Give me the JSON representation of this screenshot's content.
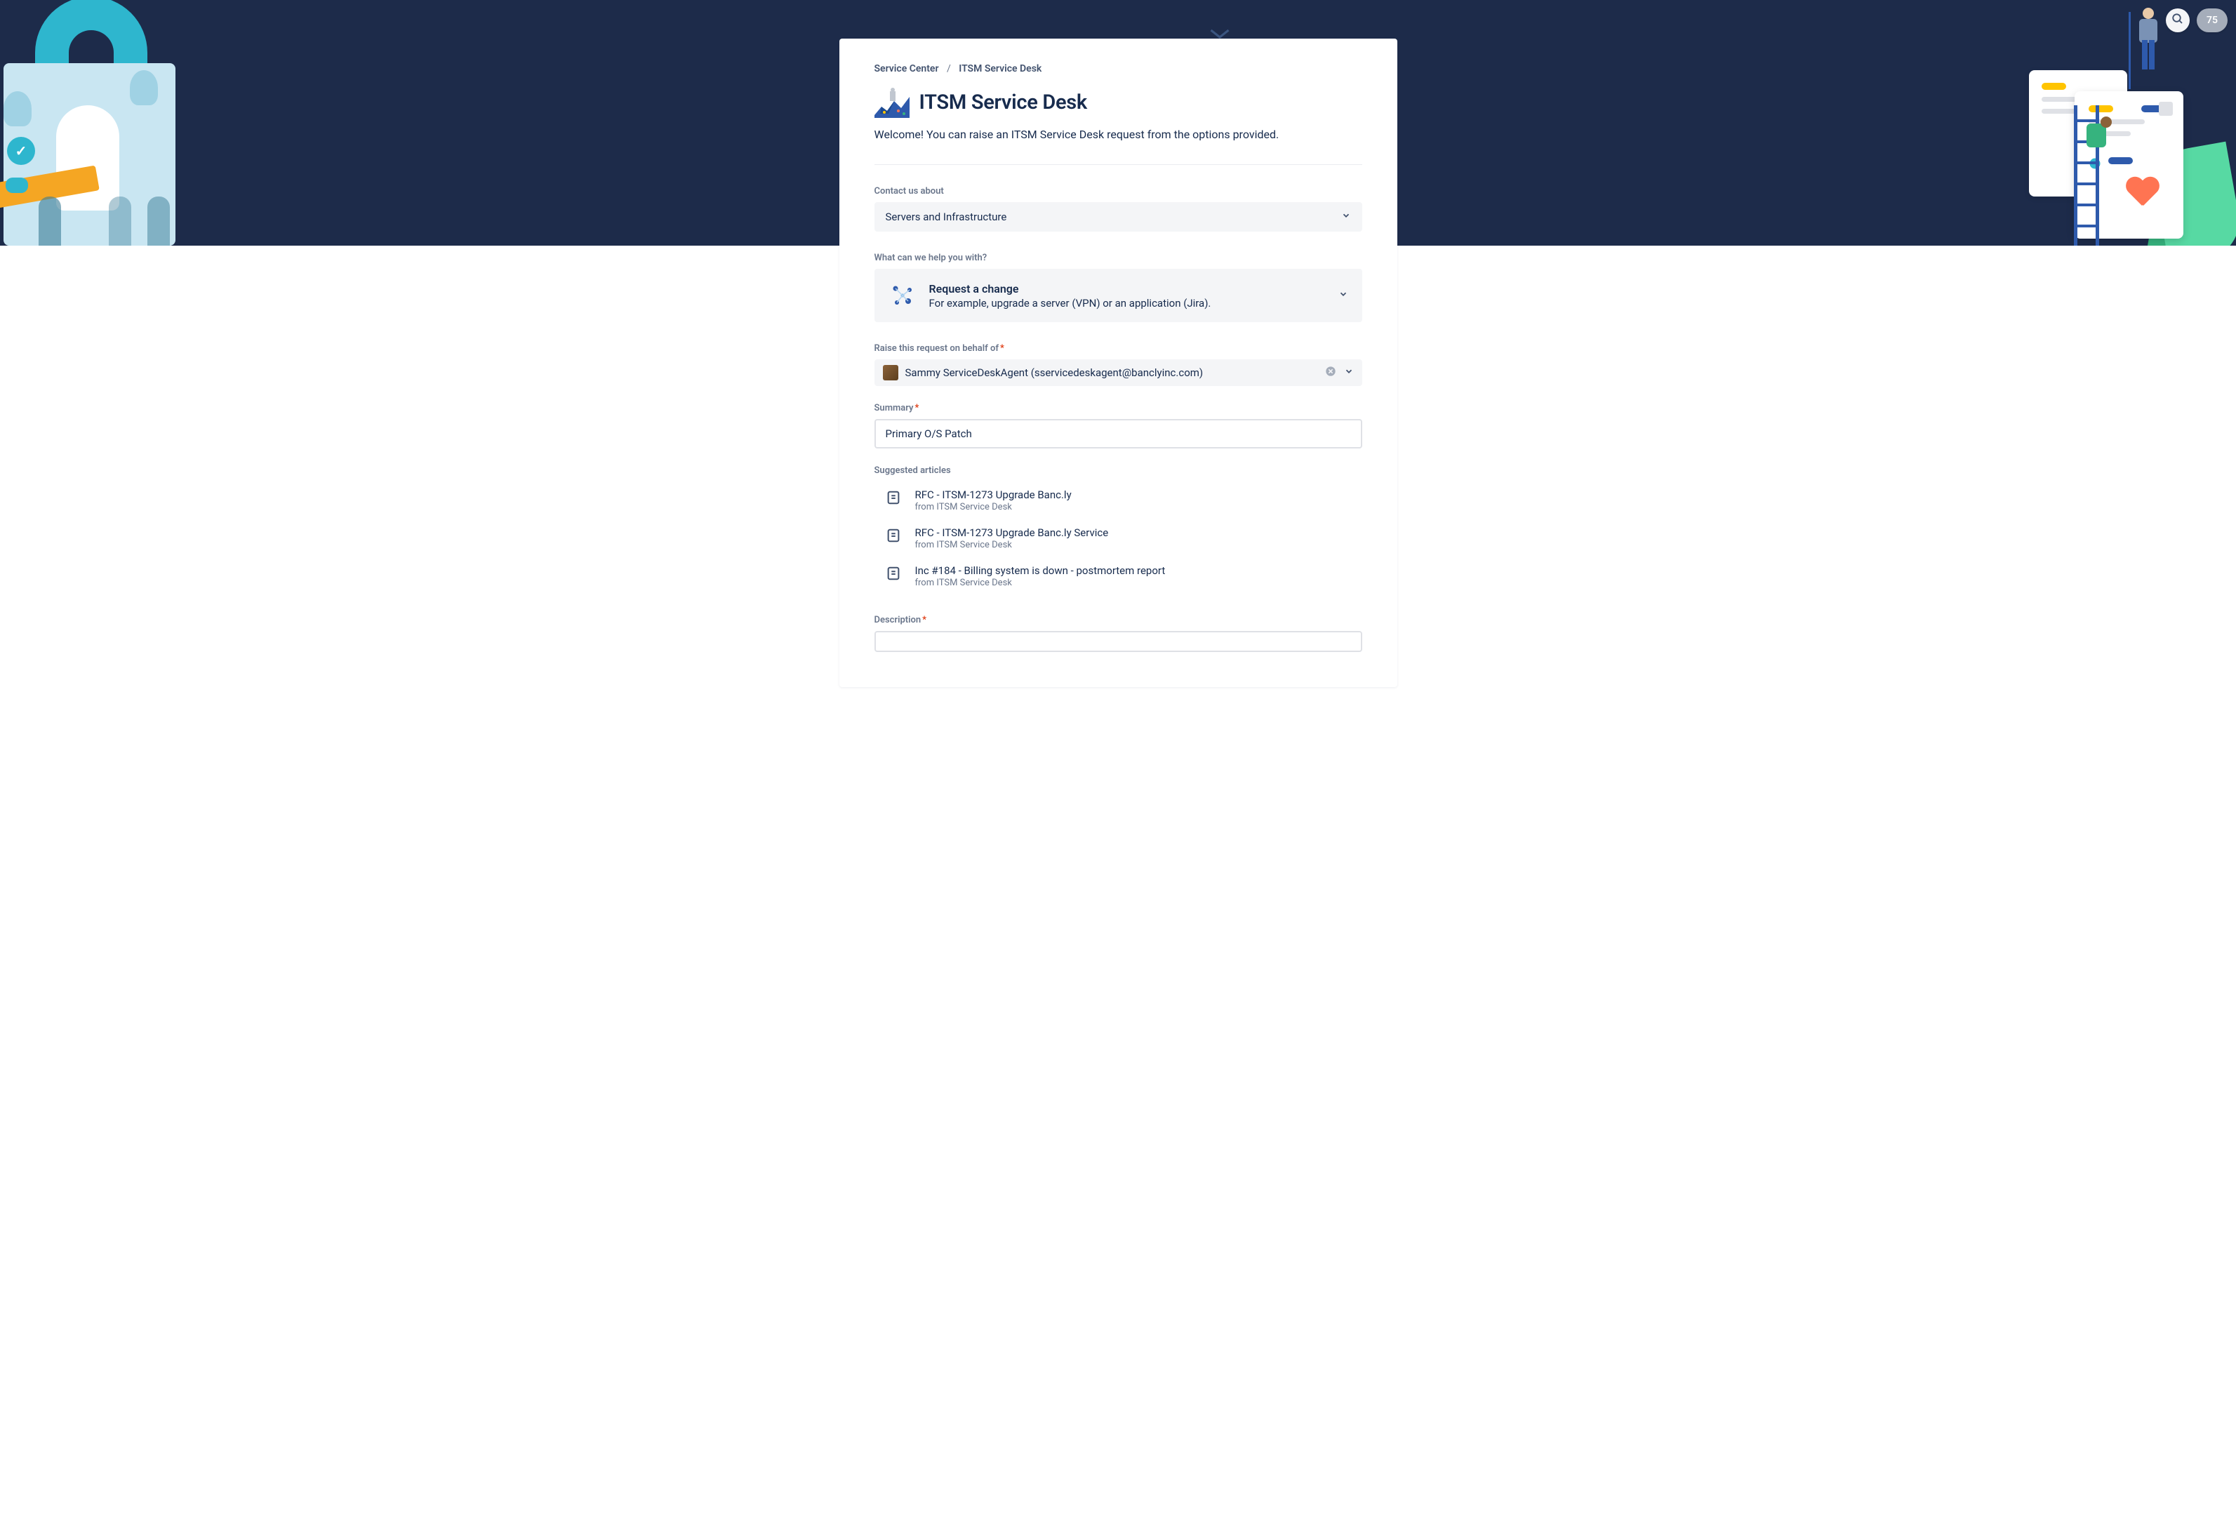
{
  "topControls": {
    "badgeCount": "75"
  },
  "breadcrumb": {
    "root": "Service Center",
    "current": "ITSM Service Desk"
  },
  "page": {
    "title": "ITSM Service Desk",
    "welcome": "Welcome! You can raise an ITSM Service Desk request from the options provided."
  },
  "contactUs": {
    "label": "Contact us about",
    "selected": "Servers and Infrastructure"
  },
  "helpWith": {
    "label": "What can we help you with?",
    "title": "Request a change",
    "desc": "For example, upgrade a server (VPN) or an application (Jira)."
  },
  "behalfOf": {
    "label": "Raise this request on behalf of",
    "selected": "Sammy ServiceDeskAgent (sservicedeskagent@banclyinc.com)"
  },
  "summary": {
    "label": "Summary",
    "value": "Primary O/S Patch"
  },
  "suggestedArticles": {
    "label": "Suggested articles",
    "items": [
      {
        "title": "RFC - ITSM-1273 Upgrade Banc.ly",
        "source": "from ITSM Service Desk"
      },
      {
        "title": "RFC - ITSM-1273 Upgrade Banc.ly Service",
        "source": "from ITSM Service Desk"
      },
      {
        "title": "Inc #184 - Billing system is down - postmortem report",
        "source": "from ITSM Service Desk"
      }
    ]
  },
  "description": {
    "label": "Description"
  }
}
